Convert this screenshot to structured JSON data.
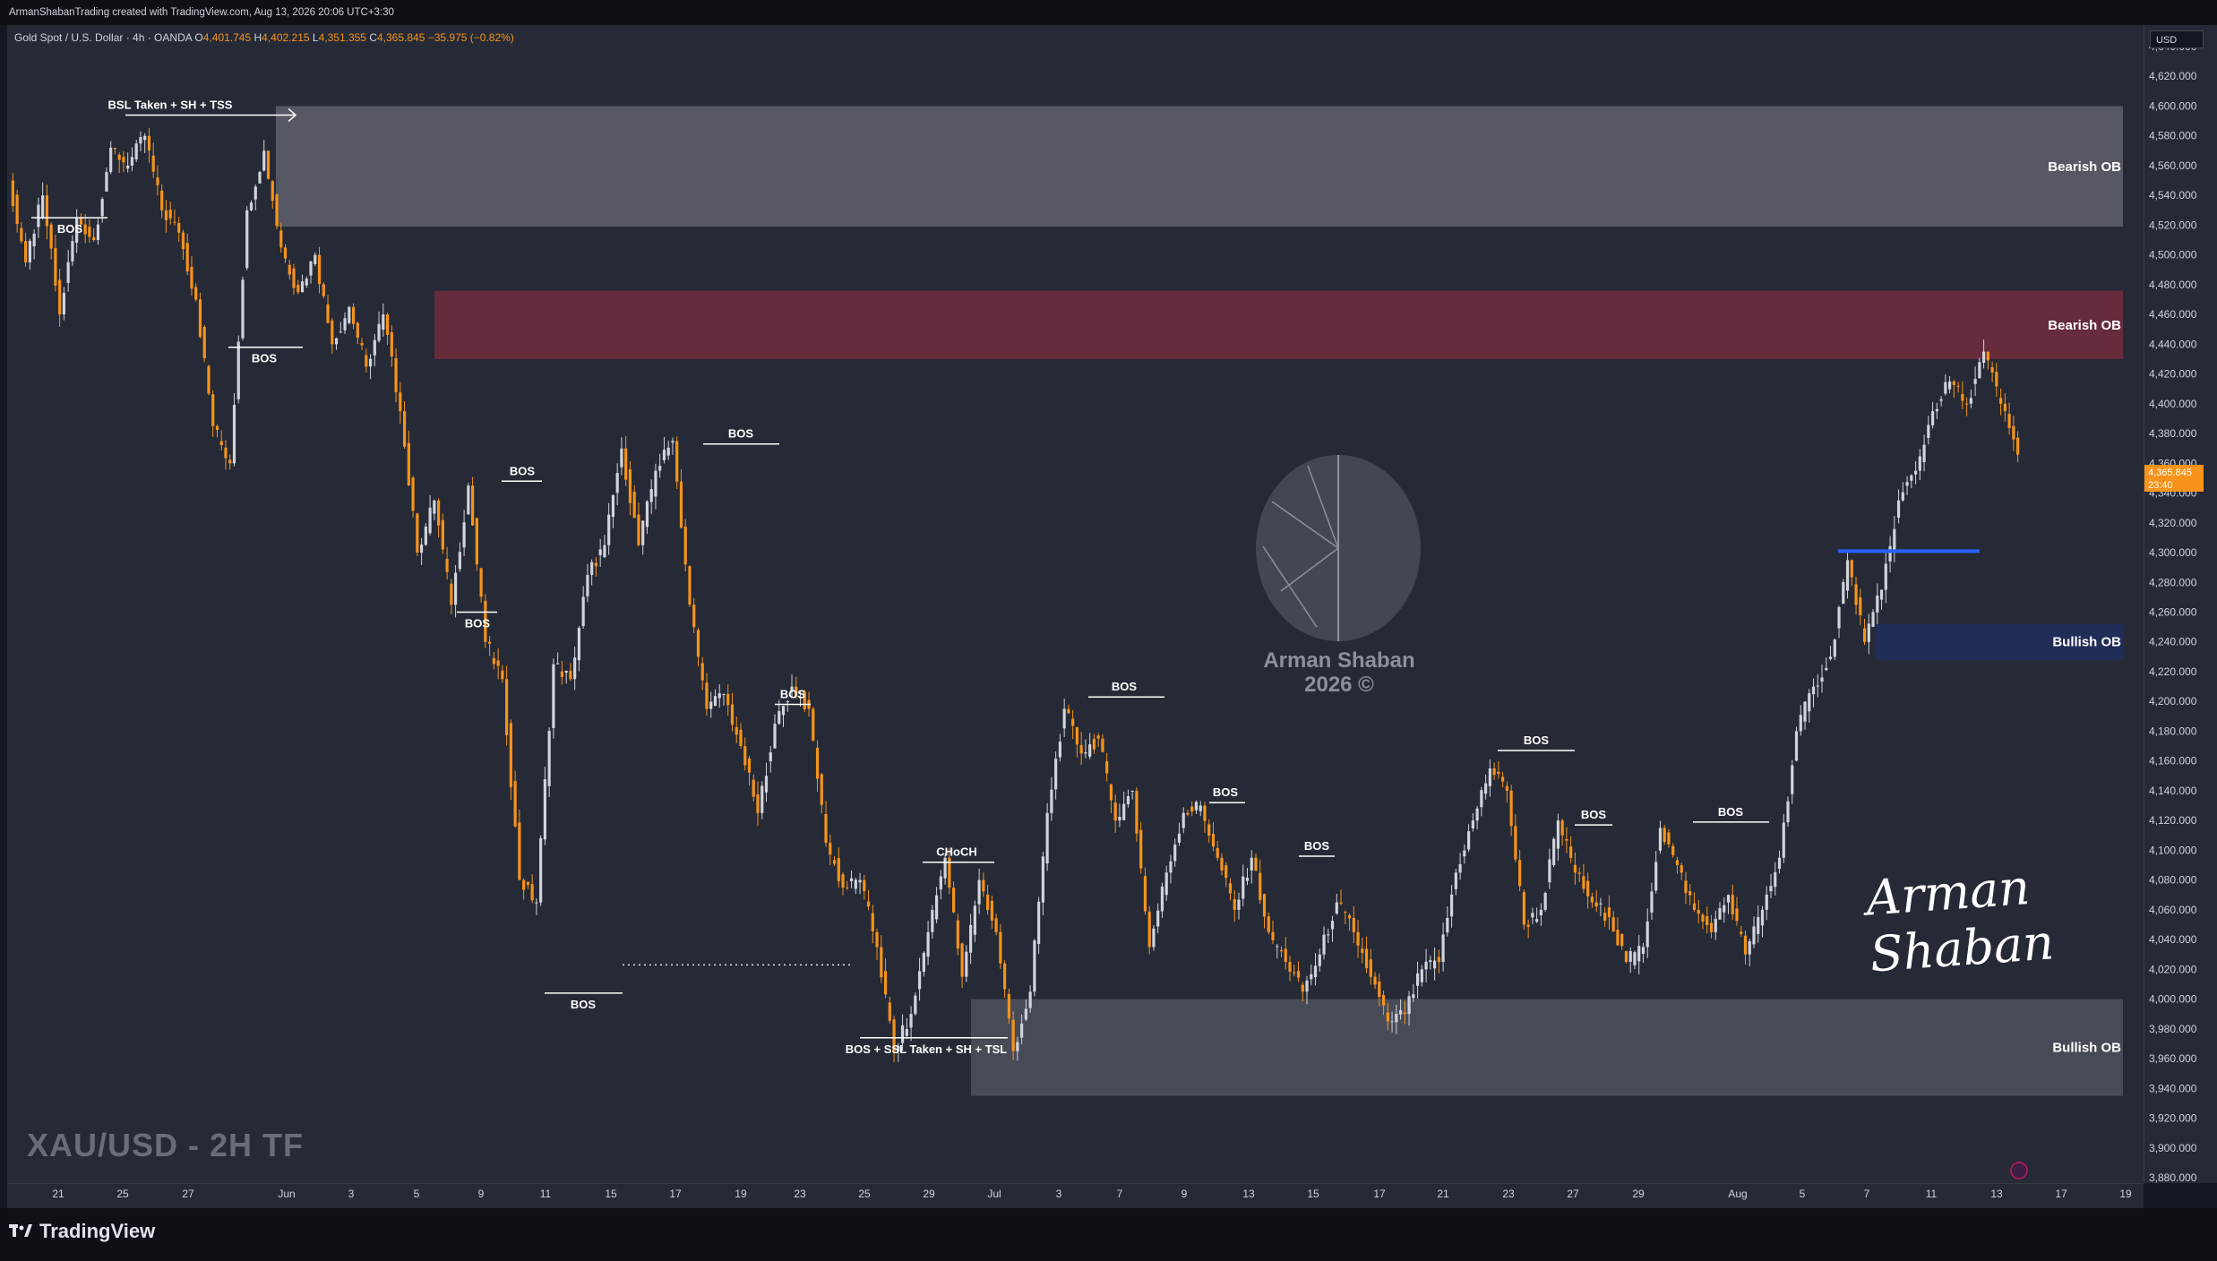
{
  "header": {
    "attribution": "ArmanShabanTrading created with TradingView.com, Aug 13, 2026 20:06 UTC+3:30"
  },
  "legend": {
    "symbol": "Gold Spot / U.S. Dollar · 4h · OANDA",
    "open_label": "O",
    "open": "4,401.745",
    "high_label": "H",
    "high": "4,402.215",
    "low_label": "L",
    "low": "4,351.355",
    "close_label": "C",
    "close": "4,365.845",
    "change": "−35.975 (−0.82%)"
  },
  "price_axis": {
    "currency": "USD",
    "current_price": "4,365.845",
    "countdown": "23:40"
  },
  "branding": {
    "footer_logo": "TradingView",
    "pair_label": "XAU/USD - 2H TF",
    "watermark_line1": "Arman Shaban",
    "watermark_line2": "2026 ©",
    "signature": "Arman Shaban"
  },
  "colors": {
    "up": "#d1d4dc",
    "down": "#f7931a",
    "background": "#252a36",
    "bearish_ob_upper": "#5a5d67",
    "bearish_ob_red": "#6b2d3c",
    "bullish_ob_blue": "#1f2e5a",
    "bullish_ob_lower": "#4a4e5a",
    "blue_line": "#2962ff"
  },
  "chart_data": {
    "type": "candlestick",
    "title": "Gold Spot / U.S. Dollar · 4h · OANDA",
    "y_ticks": [
      3880,
      3900,
      3920,
      3940,
      3960,
      3980,
      4000,
      4020,
      4040,
      4060,
      4080,
      4100,
      4120,
      4140,
      4160,
      4180,
      4200,
      4220,
      4240,
      4260,
      4280,
      4300,
      4320,
      4340,
      4360,
      4380,
      4400,
      4420,
      4440,
      4460,
      4480,
      4500,
      4520,
      4540,
      4560,
      4580,
      4600,
      4620,
      4640
    ],
    "y_tick_labels": [
      "3,880.000",
      "3,900.000",
      "3,920.000",
      "3,940.000",
      "3,960.000",
      "3,980.000",
      "4,000.000",
      "4,020.000",
      "4,040.000",
      "4,060.000",
      "4,080.000",
      "4,100.000",
      "4,120.000",
      "4,140.000",
      "4,160.000",
      "4,180.000",
      "4,200.000",
      "4,220.000",
      "4,240.000",
      "4,260.000",
      "4,280.000",
      "4,300.000",
      "4,320.000",
      "4,340.000",
      "4,360.000",
      "4,380.000",
      "4,400.000",
      "4,420.000",
      "4,440.000",
      "4,460.000",
      "4,480.000",
      "4,500.000",
      "4,520.000",
      "4,540.000",
      "4,560.000",
      "4,580.000",
      "4,600.000",
      "4,620.000",
      "4,640.000"
    ],
    "ylim": [
      3876,
      4668
    ],
    "x_ticks": [
      "21",
      "25",
      "27",
      "Jun",
      "3",
      "5",
      "9",
      "11",
      "15",
      "17",
      "19",
      "23",
      "25",
      "29",
      "Jul",
      "3",
      "7",
      "9",
      "13",
      "15",
      "17",
      "21",
      "23",
      "27",
      "29",
      "Aug",
      "5",
      "7",
      "11",
      "13",
      "17",
      "19"
    ],
    "path": [
      4550,
      4495,
      4540,
      4460,
      4525,
      4510,
      4572,
      4560,
      4580,
      4530,
      4515,
      4470,
      4385,
      4360,
      4530,
      4570,
      4505,
      4475,
      4500,
      4440,
      4465,
      4425,
      4460,
      4395,
      4300,
      4335,
      4265,
      4345,
      4240,
      4215,
      4080,
      4065,
      4225,
      4215,
      4285,
      4305,
      4370,
      4305,
      4355,
      4375,
      4265,
      4195,
      4205,
      4170,
      4125,
      4185,
      4210,
      4195,
      4105,
      4075,
      4080,
      4035,
      3965,
      3990,
      4045,
      4095,
      4015,
      4080,
      4045,
      3965,
      4005,
      4125,
      4195,
      4165,
      4175,
      4120,
      4140,
      4035,
      4085,
      4125,
      4130,
      4095,
      4060,
      4095,
      4045,
      4025,
      4005,
      4030,
      4065,
      4045,
      4015,
      3985,
      3990,
      4020,
      4025,
      4085,
      4120,
      4155,
      4140,
      4050,
      4060,
      4120,
      4085,
      4065,
      4055,
      4025,
      4035,
      4115,
      4090,
      4060,
      4045,
      4070,
      4030,
      4060,
      4095,
      4180,
      4210,
      4230,
      4295,
      4240,
      4275,
      4335,
      4355,
      4395,
      4415,
      4400,
      4435,
      4400,
      4365.845
    ],
    "levels": [
      {
        "label": "Bearish OB",
        "from": 4519,
        "to": 4600
      },
      {
        "label": "Bearish OB",
        "from": 4430,
        "to": 4476
      },
      {
        "label": "Bullish OB",
        "from": 4228,
        "to": 4252
      },
      {
        "label": "Bullish OB",
        "from": 3935,
        "to": 4000
      }
    ],
    "blue_level": 4301,
    "annotations": [
      {
        "text": "BSL Taken + SH + TSS",
        "price": 4594
      },
      {
        "text": "BOS",
        "price": 4525
      },
      {
        "text": "BOS",
        "price": 4438
      },
      {
        "text": "BOS",
        "price": 4348
      },
      {
        "text": "BOS",
        "price": 4260
      },
      {
        "text": "BOS",
        "price": 4373
      },
      {
        "text": "BOS",
        "price": 4198
      },
      {
        "text": "BOS",
        "price": 4004
      },
      {
        "text": "BOS",
        "price": 4203
      },
      {
        "text": "CHoCH",
        "price": 4092
      },
      {
        "text": "BOS + SSL Taken + SH + TSL",
        "price": 3974
      },
      {
        "text": "BOS",
        "price": 4132
      },
      {
        "text": "BOS",
        "price": 4096
      },
      {
        "text": "BOS",
        "price": 4167
      },
      {
        "text": "BOS",
        "price": 4117
      },
      {
        "text": "BOS",
        "price": 4119
      }
    ]
  }
}
